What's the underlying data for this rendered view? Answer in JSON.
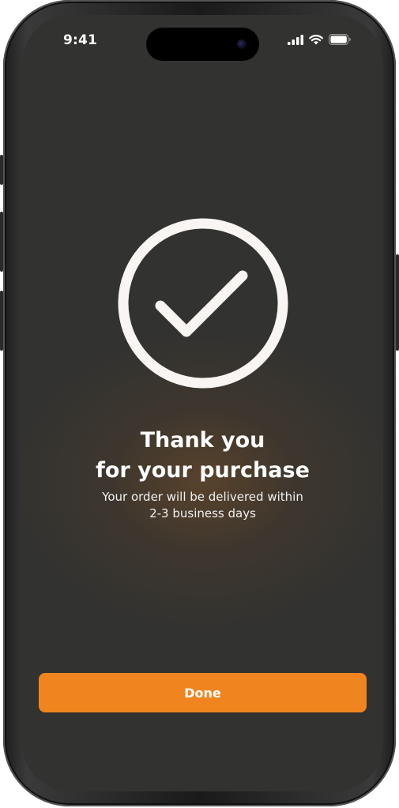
{
  "status_bar": {
    "time": "9:41",
    "icons": [
      "cellular-signal-icon",
      "wifi-icon",
      "battery-icon"
    ]
  },
  "confirmation": {
    "icon": "checkmark-circle-icon",
    "title_line1": "Thank you",
    "title_line2": "for your purchase",
    "message_line1": "Your order will be delivered within",
    "message_line2": "2-3 business days"
  },
  "actions": {
    "done_label": "Done"
  },
  "colors": {
    "background": "#323230",
    "accent": "#f08520",
    "text": "#ffffff"
  }
}
